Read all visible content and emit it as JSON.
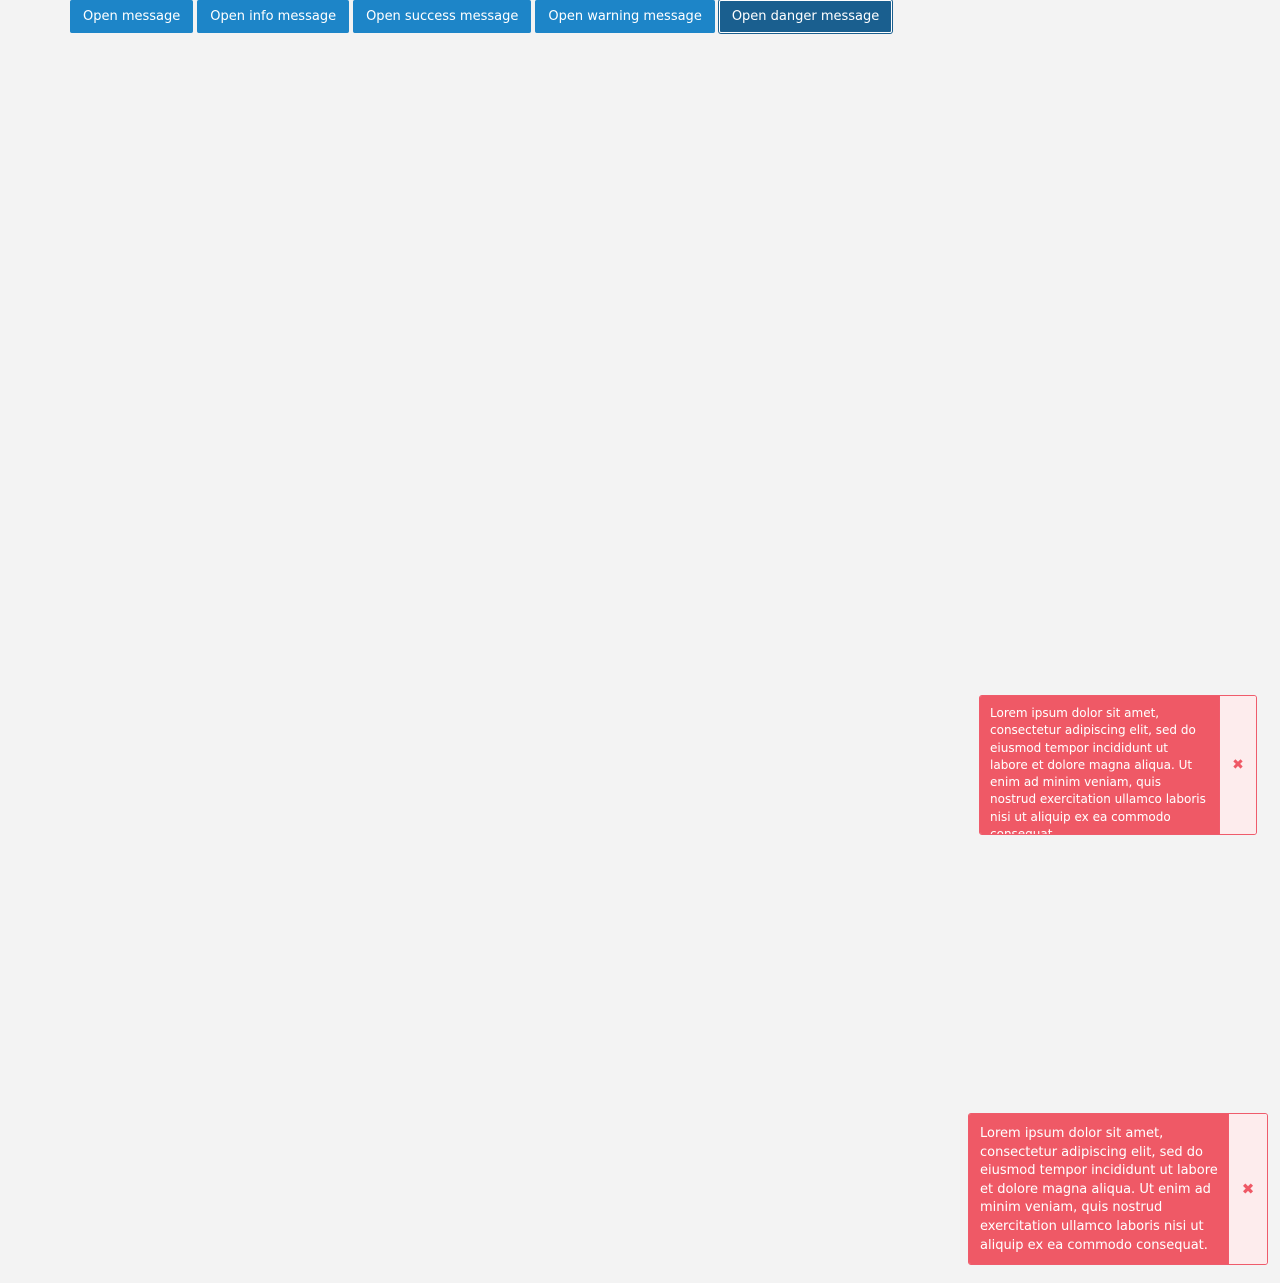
{
  "toolbar": {
    "buttons": [
      {
        "label": "Open message"
      },
      {
        "label": "Open info message"
      },
      {
        "label": "Open success message"
      },
      {
        "label": "Open warning message"
      },
      {
        "label": "Open danger message"
      }
    ]
  },
  "toasts": [
    {
      "type": "danger",
      "message": "Lorem ipsum dolor sit amet, consectetur adipiscing elit, sed do eiusmod tempor incididunt ut labore et dolore magna aliqua. Ut enim ad minim veniam, quis nostrud exercitation ullamco laboris nisi ut aliquip ex ea commodo consequat.",
      "close_icon": "close-icon",
      "close_glyph": "✖"
    },
    {
      "type": "danger",
      "message": "Lorem ipsum dolor sit amet, consectetur adipiscing elit, sed do eiusmod tempor incididunt ut labore et dolore magna aliqua. Ut enim ad minim veniam, quis nostrud exercitation ullamco laboris nisi ut aliquip ex ea commodo consequat.",
      "close_icon": "close-icon",
      "close_glyph": "✖"
    }
  ],
  "colors": {
    "background": "#f3f3f3",
    "primary": "#1d85c8",
    "primary_focused": "#1a5f8f",
    "danger": "#ef5966",
    "danger_light": "#fdeced"
  }
}
